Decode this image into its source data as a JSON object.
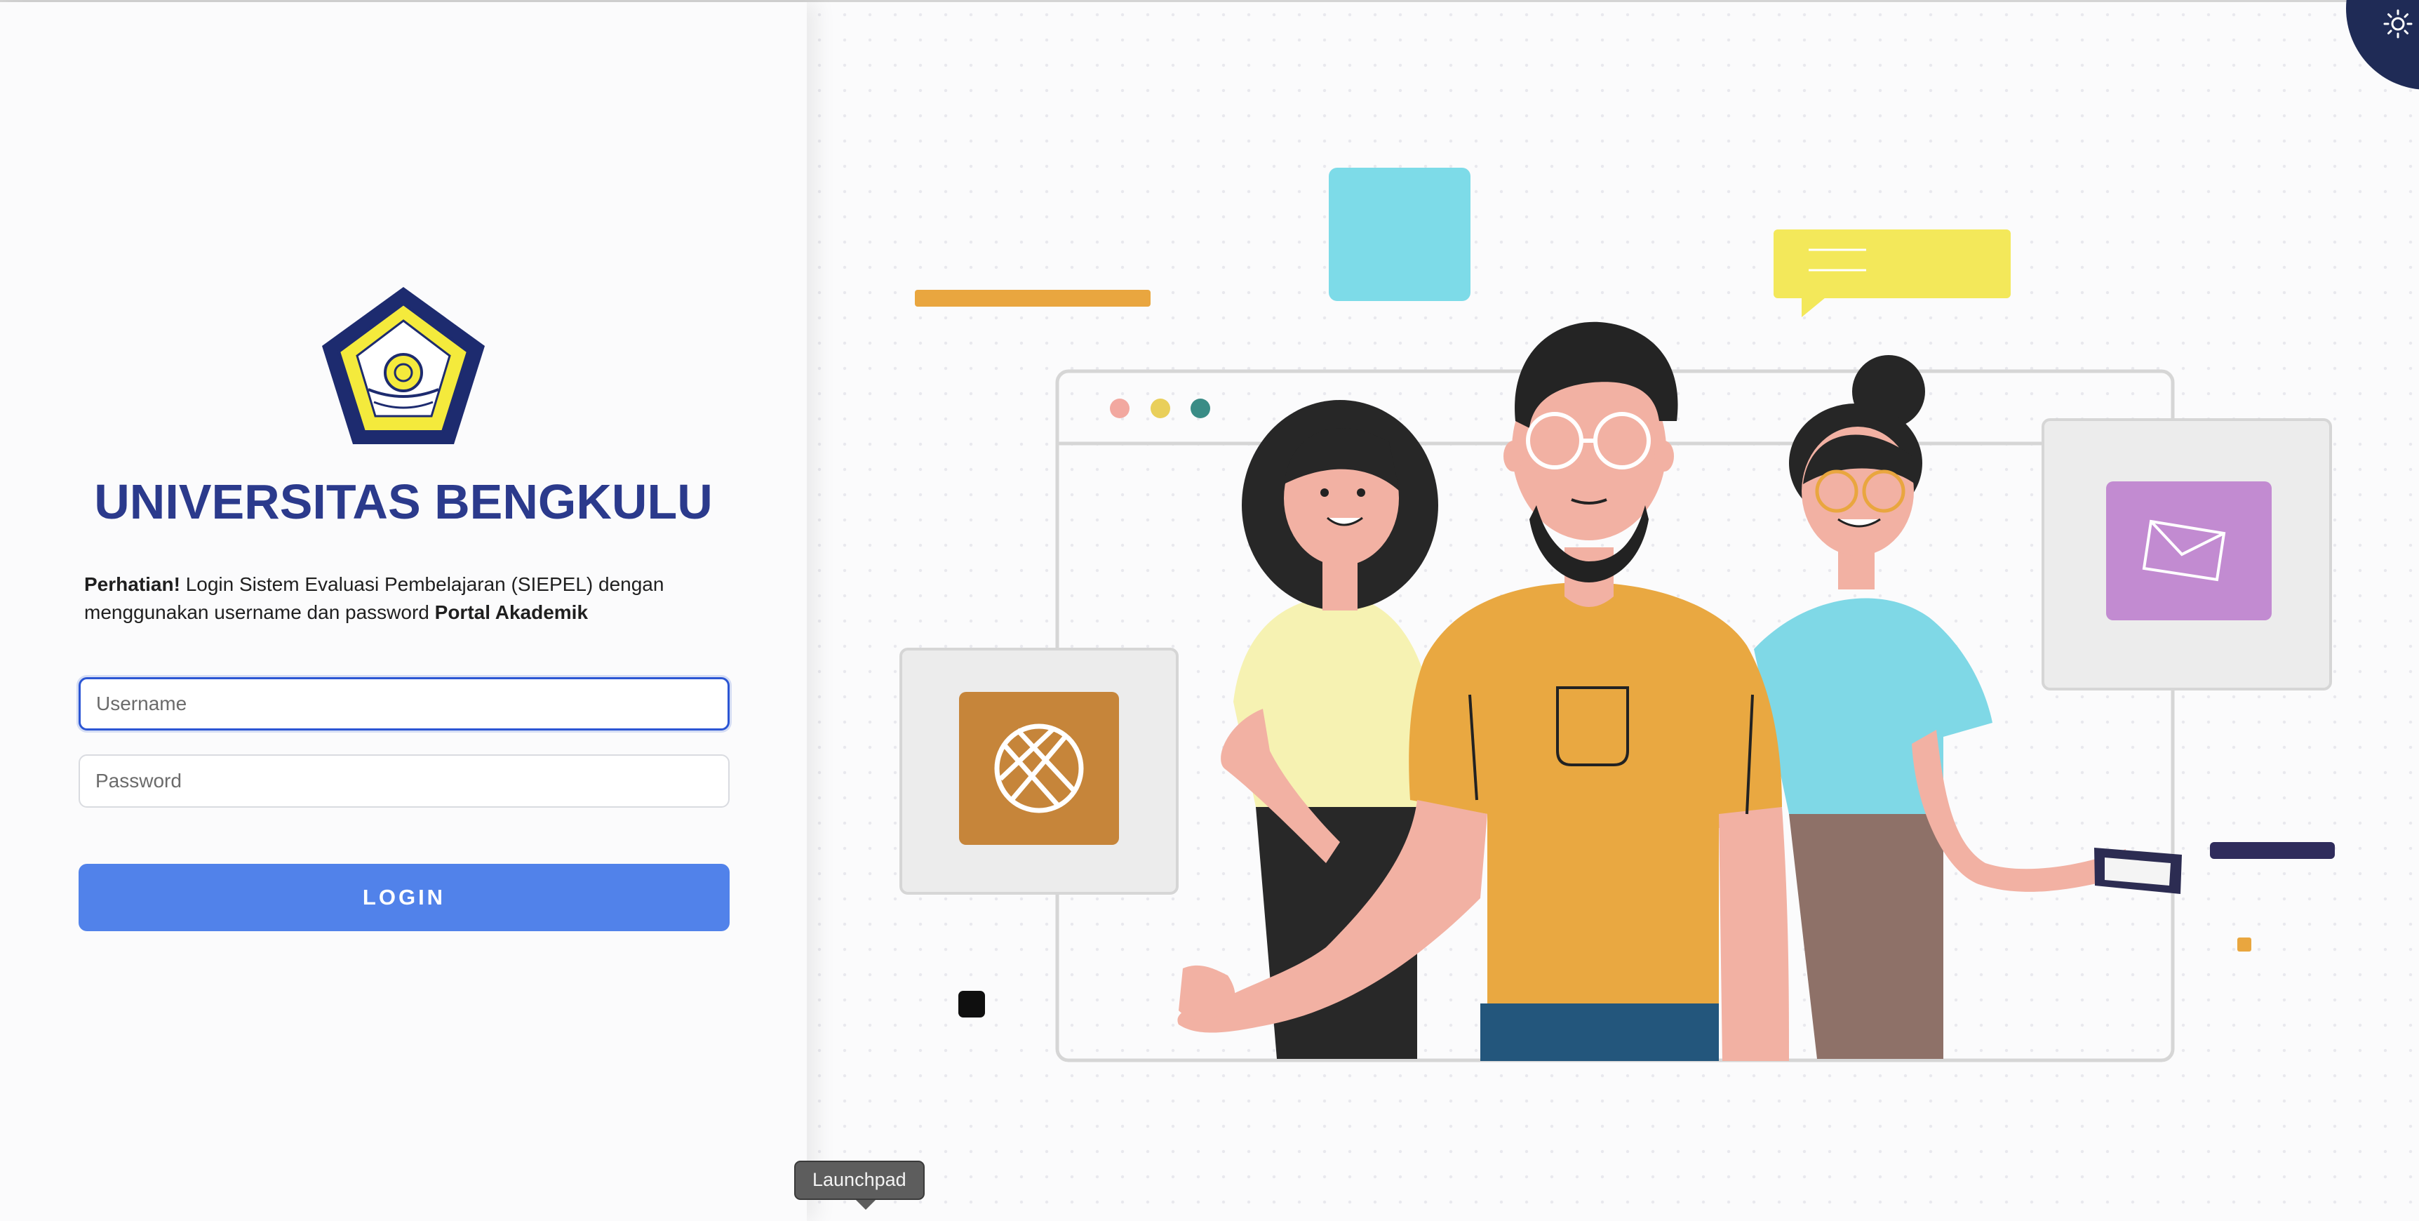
{
  "brand": {
    "name": "UNIVERSITAS BENGKULU"
  },
  "notice": {
    "lead": "Perhatian!",
    "text": " Login Sistem Evaluasi Pembelajaran (SIEPEL) dengan menggunakan username dan password ",
    "emph": "Portal Akademik"
  },
  "form": {
    "username_placeholder": "Username",
    "password_placeholder": "Password",
    "login_label": "LOGIN"
  },
  "tooltip": {
    "label": "Launchpad"
  },
  "icons": {
    "theme": "sun-icon",
    "globe": "globe-icon",
    "mail": "envelope-icon"
  },
  "colors": {
    "brand_text": "#2b3a8c",
    "button": "#5182ea",
    "focus": "#2c56d4",
    "toggle": "#1f2b56"
  }
}
